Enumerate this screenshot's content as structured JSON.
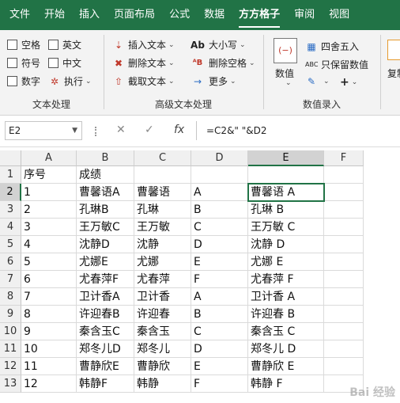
{
  "tabs": [
    "文件",
    "开始",
    "插入",
    "页面布局",
    "公式",
    "数据",
    "方方格子",
    "审阅",
    "视图"
  ],
  "active_tab_index": 6,
  "ribbon": {
    "text_group": {
      "title": "文本处理",
      "checkboxes": [
        "空格",
        "英文",
        "符号",
        "中文",
        "数字"
      ],
      "exec_label": "执行"
    },
    "adv_group": {
      "title": "高级文本处理",
      "insert_text": "插入文本",
      "delete_text": "删除文本",
      "extract_text": "截取文本",
      "case_label": "大小写",
      "delete_space": "删除空格",
      "more": "更多"
    },
    "num_group": {
      "title": "数值录入",
      "value_label": "数值",
      "round": "四舍五入",
      "keep_value": "只保留数值",
      "plus": "+"
    },
    "cut_label": "复制"
  },
  "formula_bar": {
    "name_box": "E2",
    "cancel_symbol": "✕",
    "confirm_symbol": "✓",
    "fx_symbol": "fx",
    "formula": "=C2&\"  \"&D2"
  },
  "grid": {
    "columns": [
      "A",
      "B",
      "C",
      "D",
      "E",
      "F"
    ],
    "selected_col": "E",
    "selected_row": 2,
    "rows": [
      [
        "序号",
        "成绩",
        "",
        "",
        "",
        ""
      ],
      [
        "1",
        "曹馨语A",
        "曹馨语",
        "A",
        "曹馨语  A",
        ""
      ],
      [
        "2",
        "孔琳B",
        "孔琳",
        "B",
        "孔琳  B",
        ""
      ],
      [
        "3",
        "王万敏C",
        "王万敏",
        "C",
        "王万敏  C",
        ""
      ],
      [
        "4",
        "沈静D",
        "沈静",
        "D",
        "沈静  D",
        ""
      ],
      [
        "5",
        "尤娜E",
        "尤娜",
        "E",
        "尤娜  E",
        ""
      ],
      [
        "6",
        "尤春萍F",
        "尤春萍",
        "F",
        "尤春萍  F",
        ""
      ],
      [
        "7",
        "卫计香A",
        "卫计香",
        "A",
        "卫计香  A",
        ""
      ],
      [
        "8",
        "许迎春B",
        "许迎春",
        "B",
        "许迎春  B",
        ""
      ],
      [
        "9",
        "秦含玉C",
        "秦含玉",
        "C",
        "秦含玉  C",
        ""
      ],
      [
        "10",
        "郑冬儿D",
        "郑冬儿",
        "D",
        "郑冬儿  D",
        ""
      ],
      [
        "11",
        "曹静欣E",
        "曹静欣",
        "E",
        "曹静欣  E",
        ""
      ],
      [
        "12",
        "韩静F",
        "韩静",
        "F",
        "韩静  F",
        ""
      ]
    ]
  },
  "watermark": "Bai 经验"
}
